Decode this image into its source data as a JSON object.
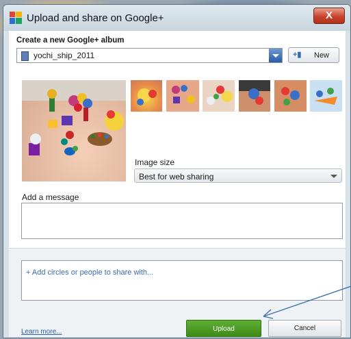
{
  "window": {
    "title": "Upload and share on Google+",
    "close_label": "X"
  },
  "album": {
    "section_label": "Create a new Google+ album",
    "selected": "yochi_ship_2011",
    "new_label": "New"
  },
  "photos": [
    {
      "name": "photo-1",
      "selected": true
    },
    {
      "name": "photo-2"
    },
    {
      "name": "photo-3"
    },
    {
      "name": "photo-4"
    },
    {
      "name": "photo-5"
    },
    {
      "name": "photo-6"
    },
    {
      "name": "photo-7"
    }
  ],
  "image_size": {
    "label": "Image size",
    "selected": "Best for web sharing"
  },
  "message": {
    "label": "Add a message",
    "value": ""
  },
  "share": {
    "placeholder": "+ Add circles or people to share with..."
  },
  "footer": {
    "learn_more": "Learn more...",
    "upload_label": "Upload",
    "cancel_label": "Cancel"
  },
  "colors": {
    "upload_green": "#4a9a22",
    "accent_blue": "#2b5ba3",
    "annotation_arrow": "#3f6fae"
  }
}
